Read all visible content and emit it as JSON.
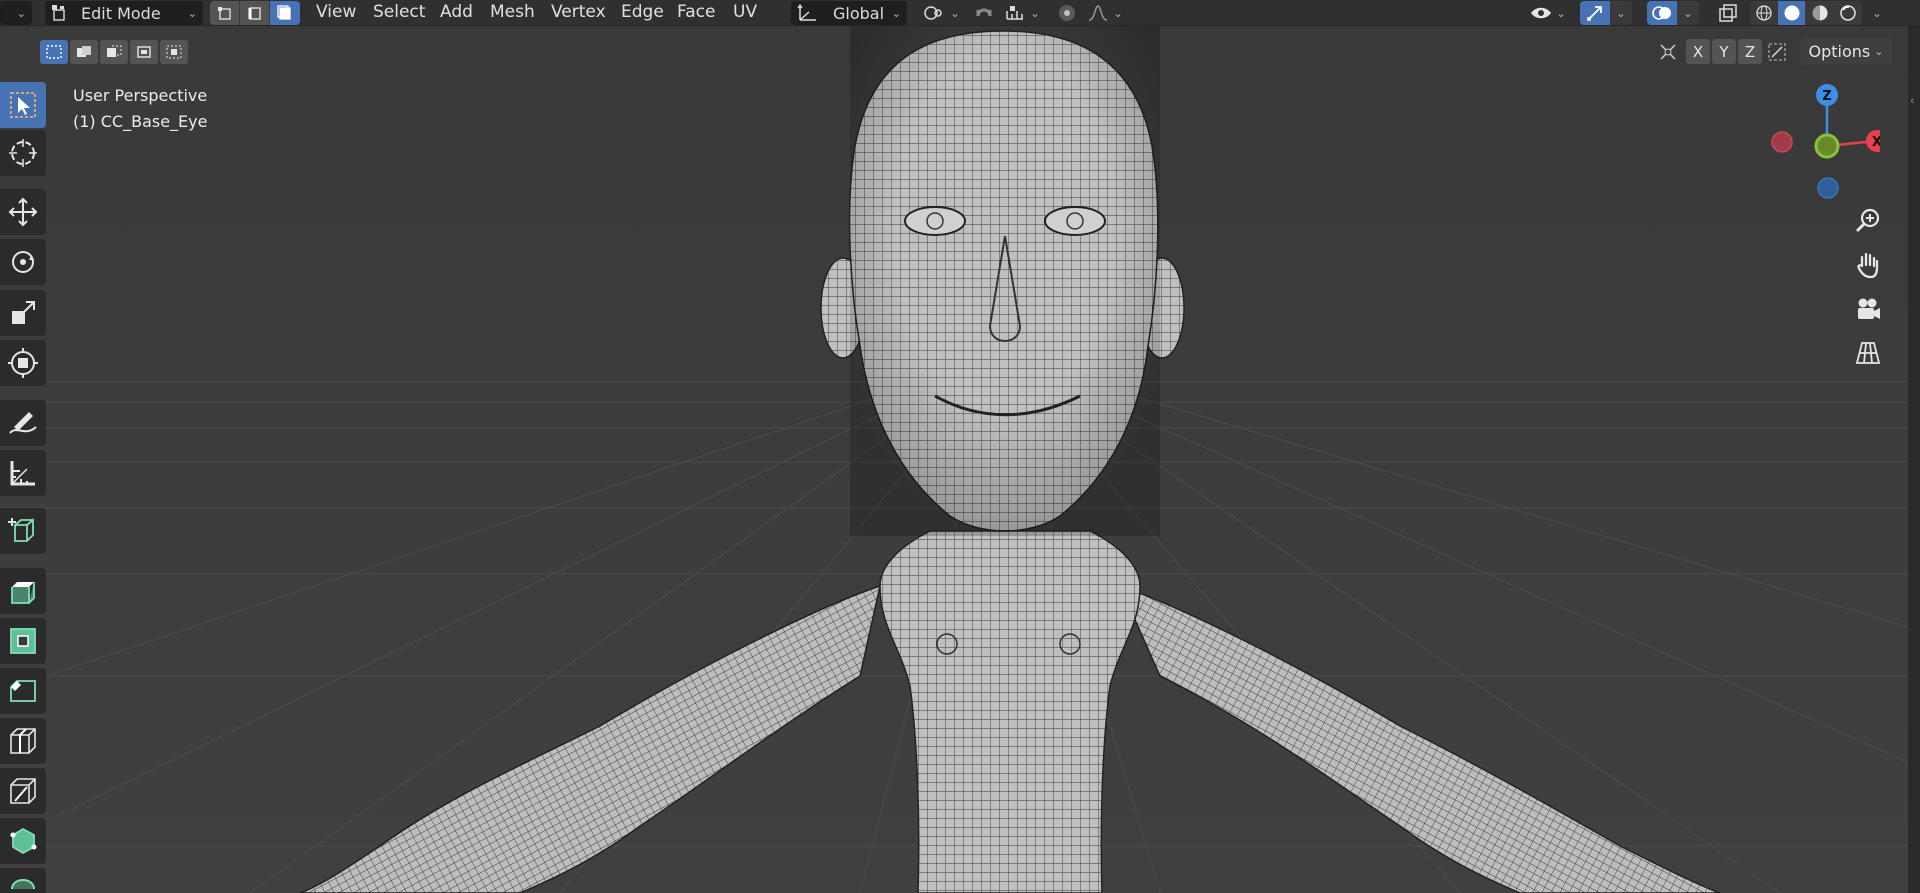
{
  "header": {
    "mode_label": "Edit Mode",
    "menu": [
      "View",
      "Select",
      "Add",
      "Mesh",
      "Vertex",
      "Edge",
      "Face",
      "UV"
    ],
    "transform_orientation": "Global"
  },
  "subheader": {
    "axes": [
      "X",
      "Y",
      "Z"
    ],
    "options_label": "Options"
  },
  "viewport": {
    "perspective_label": "User Perspective",
    "object_label": "(1) CC_Base_Eye"
  },
  "gizmo": {
    "z_label": "Z",
    "x_label": "X",
    "colors": {
      "x": "#e8404f",
      "y": "#86c43b",
      "z": "#3d8ee6",
      "neg_x": "#a03a46",
      "neg_z": "#2f5f9b"
    }
  },
  "colors": {
    "accent": "#4772b3",
    "header_bg": "#303030",
    "viewport_bg": "#3d3d3d",
    "mesh_fill": "#b9b9b9",
    "wire": "#2a2a2a",
    "tool_edit": "#7fe0b3"
  },
  "icons": {
    "editor_type": "view3d-icon",
    "mode": "editmode-icon",
    "select_modes": [
      "vertex-select-icon",
      "edge-select-icon",
      "face-select-icon"
    ],
    "orientation": "orientation-global-icon",
    "pivot": "pivot-icon",
    "snap": "magnet-icon",
    "proportional": "proportional-edit-icon",
    "visibility": "eye-icon",
    "gizmo_toggle": "gizmo-icon",
    "overlays": "overlay-icon",
    "xray": "xray-icon",
    "shading": [
      "wireframe-shading-icon",
      "solid-shading-icon",
      "material-shading-icon",
      "rendered-shading-icon"
    ],
    "toolbar": [
      "select-box-icon",
      "cursor-icon",
      "move-icon",
      "rotate-icon",
      "scale-icon",
      "transform-icon",
      "annotate-icon",
      "measure-icon",
      "add-cube-icon",
      "extrude-icon",
      "inset-icon",
      "bevel-icon",
      "loop-cut-icon",
      "knife-icon",
      "poly-build-icon",
      "spin-icon"
    ],
    "nav": [
      "zoom-icon",
      "pan-hand-icon",
      "camera-icon",
      "ortho-grid-icon"
    ]
  }
}
